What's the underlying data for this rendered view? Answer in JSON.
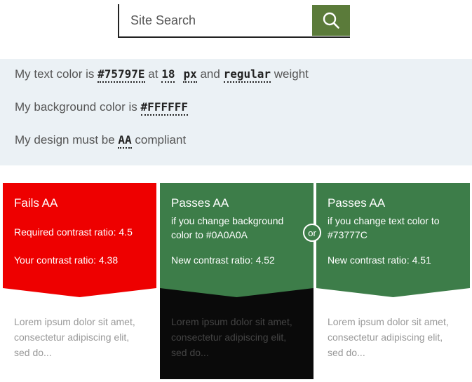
{
  "search": {
    "placeholder": "Site Search",
    "button_icon": "search-icon",
    "button_color": "#5b7b3a"
  },
  "settings": {
    "text_color_prefix": "My text color is",
    "text_color": "#75797E",
    "at": "at",
    "size_value": "18",
    "size_unit": "px",
    "and": "and",
    "weight": "regular",
    "weight_suffix": "weight",
    "bg_prefix": "My background color is",
    "bg_color": "#FFFFFF",
    "compliance_prefix": "My design must be",
    "compliance_level": "AA",
    "compliance_suffix": "compliant",
    "panel_color": "#ebf1f5"
  },
  "cards": {
    "fail": {
      "title": "Fails AA",
      "required": "Required contrast ratio: 4.5",
      "yours": "Your contrast ratio: 4.38",
      "sample": "Lorem ipsum dolor sit amet, consectetur adipiscing elit, sed do...",
      "color": "#ee0000"
    },
    "bg_fix": {
      "title": "Passes AA",
      "desc": "if you change background color to #0A0A0A",
      "ratio": "New contrast ratio: 4.52",
      "sample": "Lorem ipsum dolor sit amet, consectetur adipiscing elit, sed do...",
      "color": "#3d7d49"
    },
    "or_label": "or",
    "text_fix": {
      "title": "Passes AA",
      "desc": "if you change text color to #73777C",
      "ratio": "New contrast ratio: 4.51",
      "sample": "Lorem ipsum dolor sit amet, consectetur adipiscing elit, sed do...",
      "color": "#3d7d49"
    }
  }
}
